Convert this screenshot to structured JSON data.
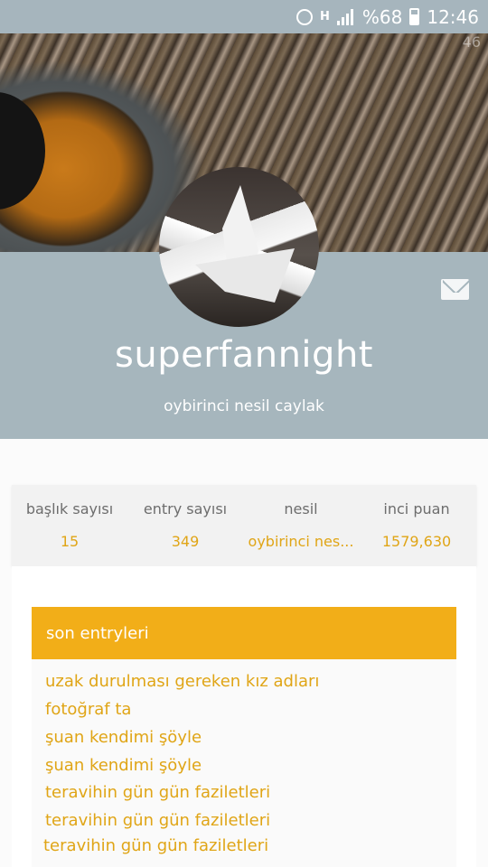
{
  "status_bar": {
    "battery": "%68",
    "time": "12:46",
    "network": "H"
  },
  "cover": {
    "corner_text": "46"
  },
  "profile": {
    "username": "superfannight",
    "subtitle": "oybirinci nesil caylak"
  },
  "stats": [
    {
      "label": "başlık sayısı",
      "value": "15"
    },
    {
      "label": "entry sayısı",
      "value": "349"
    },
    {
      "label": "nesil",
      "value": "oybirinci nes..."
    },
    {
      "label": "inci puan",
      "value": "1579,630"
    }
  ],
  "entries": {
    "title": "son entryleri",
    "items": [
      "uzak durulması gereken kız adları",
      "fotoğraf ta",
      "şuan kendimi şöyle",
      "şuan kendimi şöyle",
      "teravihin gün gün faziletleri",
      "teravihin gün gün faziletleri",
      "teravihin gün gün faziletleri"
    ]
  },
  "icons": {
    "mail": "mail-icon",
    "alarm": "alarm-icon",
    "signal": "signal-icon",
    "battery": "battery-icon"
  },
  "colors": {
    "accent": "#f2ae18",
    "accent_text": "#e0a516",
    "header_band": "#a6b6bd"
  }
}
